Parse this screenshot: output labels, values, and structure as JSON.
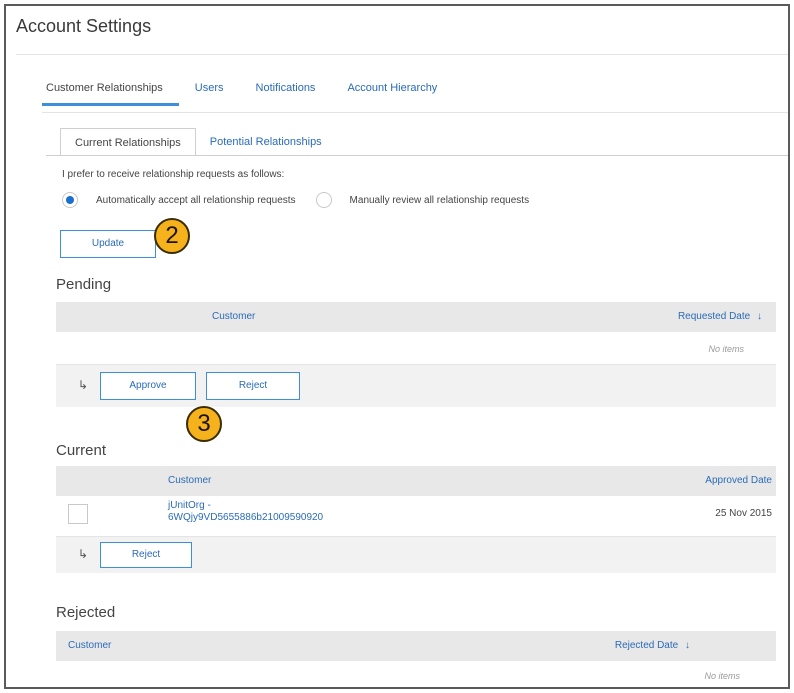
{
  "page": {
    "title": "Account Settings"
  },
  "main_tabs": [
    {
      "label": "Customer Relationships",
      "active": true
    },
    {
      "label": "Users",
      "active": false
    },
    {
      "label": "Notifications",
      "active": false
    },
    {
      "label": "Account Hierarchy",
      "active": false
    }
  ],
  "sub_tabs": [
    {
      "label": "Current Relationships",
      "active": true
    },
    {
      "label": "Potential Relationships",
      "active": false
    }
  ],
  "preference": {
    "prompt": "I prefer to receive relationship requests as follows:",
    "options": [
      {
        "label": "Automatically accept all relationship requests",
        "selected": true
      },
      {
        "label": "Manually review all relationship requests",
        "selected": false
      }
    ],
    "update_label": "Update"
  },
  "callouts": {
    "step2": "2",
    "step3": "3"
  },
  "pending": {
    "title": "Pending",
    "columns": {
      "customer": "Customer",
      "requested_date": "Requested Date"
    },
    "sort_icon": "↓",
    "empty_text": "No items",
    "approve_label": "Approve",
    "reject_label": "Reject"
  },
  "current": {
    "title": "Current",
    "columns": {
      "customer": "Customer",
      "approved_date": "Approved Date"
    },
    "rows": [
      {
        "customer_line1": "jUnitOrg -",
        "customer_line2": "6WQjy9VD5655886b21009590920",
        "approved_date": "25 Nov 2015"
      }
    ],
    "reject_label": "Reject"
  },
  "rejected": {
    "title": "Rejected",
    "columns": {
      "customer": "Customer",
      "rejected_date": "Rejected Date"
    },
    "sort_icon": "↓",
    "empty_text": "No items"
  },
  "icons": {
    "row_action": "↳"
  },
  "colors": {
    "accent": "#3c8fd8",
    "link": "#2a6bb8",
    "badge": "#f5b21d",
    "radio_selected": "#1a6fd0"
  }
}
